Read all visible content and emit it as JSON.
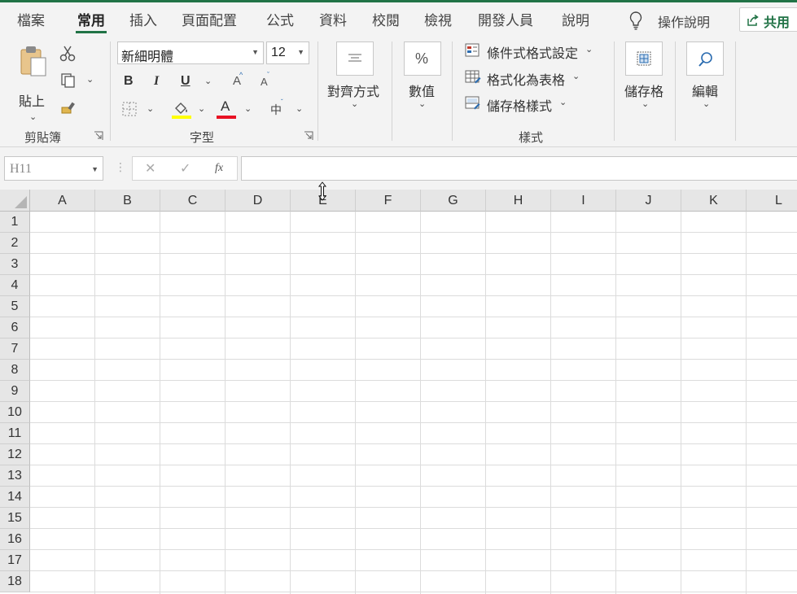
{
  "tabs": [
    {
      "id": "file",
      "label": "檔案"
    },
    {
      "id": "home",
      "label": "常用"
    },
    {
      "id": "insert",
      "label": "插入"
    },
    {
      "id": "layout",
      "label": "頁面配置"
    },
    {
      "id": "formulas",
      "label": "公式"
    },
    {
      "id": "data",
      "label": "資料"
    },
    {
      "id": "review",
      "label": "校閱"
    },
    {
      "id": "view",
      "label": "檢視"
    },
    {
      "id": "developer",
      "label": "開發人員"
    },
    {
      "id": "help",
      "label": "說明"
    }
  ],
  "tell_me": "操作說明",
  "share_label": "共用",
  "clipboard": {
    "paste_label": "貼上",
    "group_label": "剪貼簿"
  },
  "font": {
    "name": "新細明體",
    "size": "12",
    "bold": "B",
    "italic": "I",
    "underline": "U",
    "grow": "A",
    "shrink": "A",
    "font_color_letter": "A",
    "phonetic": "中",
    "group_label": "字型",
    "highlight_color": "#ffff00",
    "font_color": "#e81123"
  },
  "alignment": {
    "label": "對齊方式"
  },
  "number": {
    "label": "數值",
    "icon_text": "%"
  },
  "styles": {
    "conditional": "條件式格式設定",
    "as_table": "格式化為表格",
    "cell_styles": "儲存格樣式",
    "group_label": "樣式"
  },
  "cells": {
    "label": "儲存格"
  },
  "editing": {
    "label": "編輯"
  },
  "name_box": "H11",
  "formula_buttons": {
    "cancel": "✕",
    "enter": "✓",
    "fx": "fx"
  },
  "columns": [
    "A",
    "B",
    "C",
    "D",
    "E",
    "F",
    "G",
    "H",
    "I",
    "J",
    "K",
    "L"
  ],
  "rows": [
    "1",
    "2",
    "3",
    "4",
    "5",
    "6",
    "7",
    "8",
    "9",
    "10",
    "11",
    "12",
    "13",
    "14",
    "15",
    "16",
    "17",
    "18"
  ],
  "accent": "#217346"
}
